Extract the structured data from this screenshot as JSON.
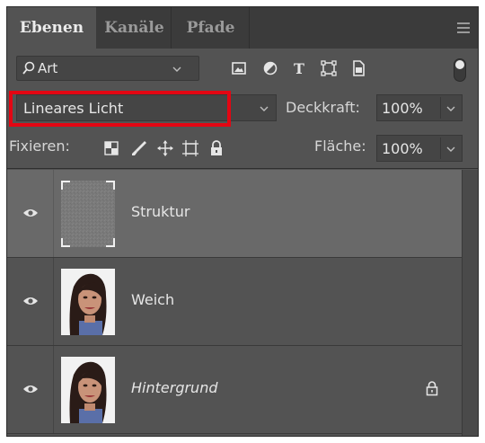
{
  "tabs": [
    {
      "label": "Ebenen",
      "active": true
    },
    {
      "label": "Kanäle",
      "active": false
    },
    {
      "label": "Pfade",
      "active": false
    }
  ],
  "filter": {
    "label": "Art",
    "icons": [
      "image-filter-icon",
      "adjustment-filter-icon",
      "type-filter-icon",
      "shape-filter-icon",
      "smart-object-filter-icon"
    ],
    "toggle_on": true
  },
  "blend": {
    "mode": "Lineares Licht",
    "opacity_label": "Deckkraft:",
    "opacity_value": "100%",
    "highlight_color": "#e30613"
  },
  "lock": {
    "label": "Fixieren:",
    "icons": [
      "lock-transparent-pixels-icon",
      "lock-image-pixels-icon",
      "lock-position-icon",
      "lock-artboard-icon",
      "lock-all-icon"
    ],
    "fill_label": "Fläche:",
    "fill_value": "100%"
  },
  "layers": [
    {
      "name": "Struktur",
      "visible": true,
      "selected": true,
      "italic": false,
      "locked": false,
      "thumb": "gray-texture"
    },
    {
      "name": "Weich",
      "visible": true,
      "selected": false,
      "italic": false,
      "locked": false,
      "thumb": "portrait"
    },
    {
      "name": "Hintergrund",
      "visible": true,
      "selected": false,
      "italic": true,
      "locked": true,
      "thumb": "portrait"
    }
  ],
  "colors": {
    "panel_bg": "#535353",
    "tabbar_bg": "#3b3b3b",
    "selected_row": "#696969"
  }
}
